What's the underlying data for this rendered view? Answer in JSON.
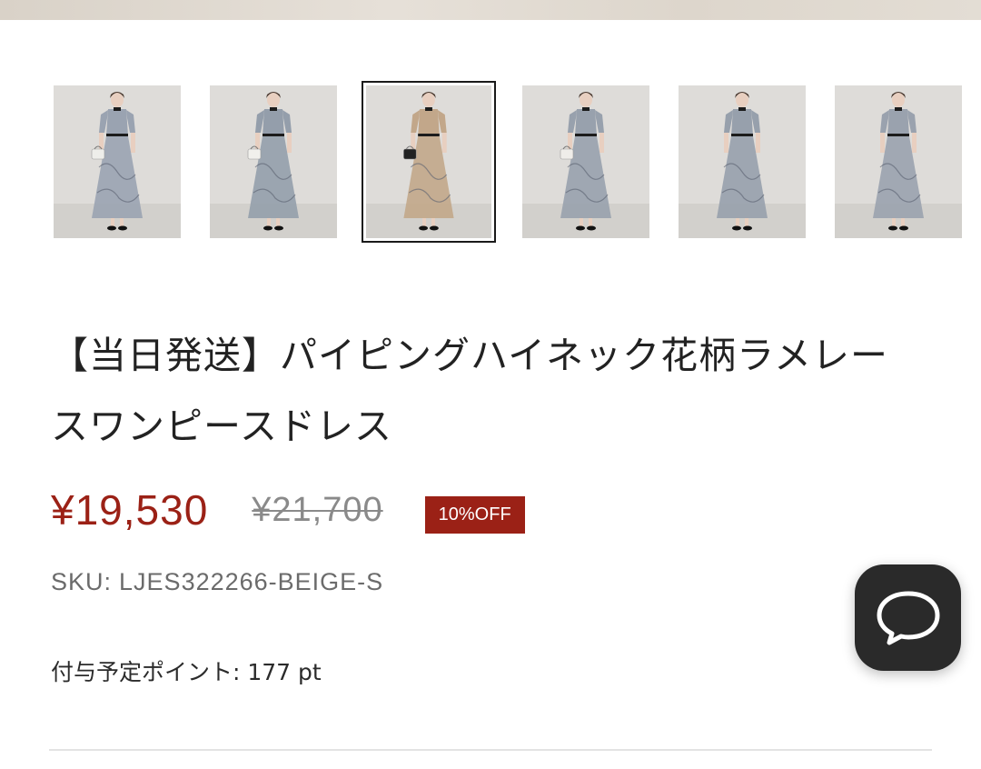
{
  "gallery": {
    "thumbnails": [
      {
        "alt": "front-view-with-bag",
        "dress_color": "#9aa3b1",
        "bag_color": "#eeeeea",
        "selected": false
      },
      {
        "alt": "front-view-closeup",
        "dress_color": "#949eab",
        "bag_color": "#f1f0ec",
        "selected": false
      },
      {
        "alt": "beige-front-view",
        "dress_color": "#c2a78a",
        "bag_color": "#222222",
        "selected": true
      },
      {
        "alt": "front-view-bag-low",
        "dress_color": "#98a1ad",
        "bag_color": "#efede9",
        "selected": false
      },
      {
        "alt": "side-view",
        "dress_color": "#97a0ac",
        "bag_color": "",
        "selected": false
      },
      {
        "alt": "back-view",
        "dress_color": "#9aa2ae",
        "bag_color": "",
        "selected": false
      }
    ]
  },
  "product": {
    "title": "【当日発送】パイピングハイネック花柄ラメレースワンピースドレス",
    "price": "¥19,530",
    "original_price": "¥21,700",
    "discount_badge": "10%OFF",
    "sku_label": "SKU:",
    "sku_value": "LJES322266-BEIGE-S",
    "points_text": "付与予定ポイント: 177 pt"
  },
  "colors": {
    "accent": "#9b2116",
    "muted": "#8a8a8a",
    "chat_bg": "#2a2a2a"
  },
  "chat": {
    "icon": "chat-bubble-icon"
  }
}
